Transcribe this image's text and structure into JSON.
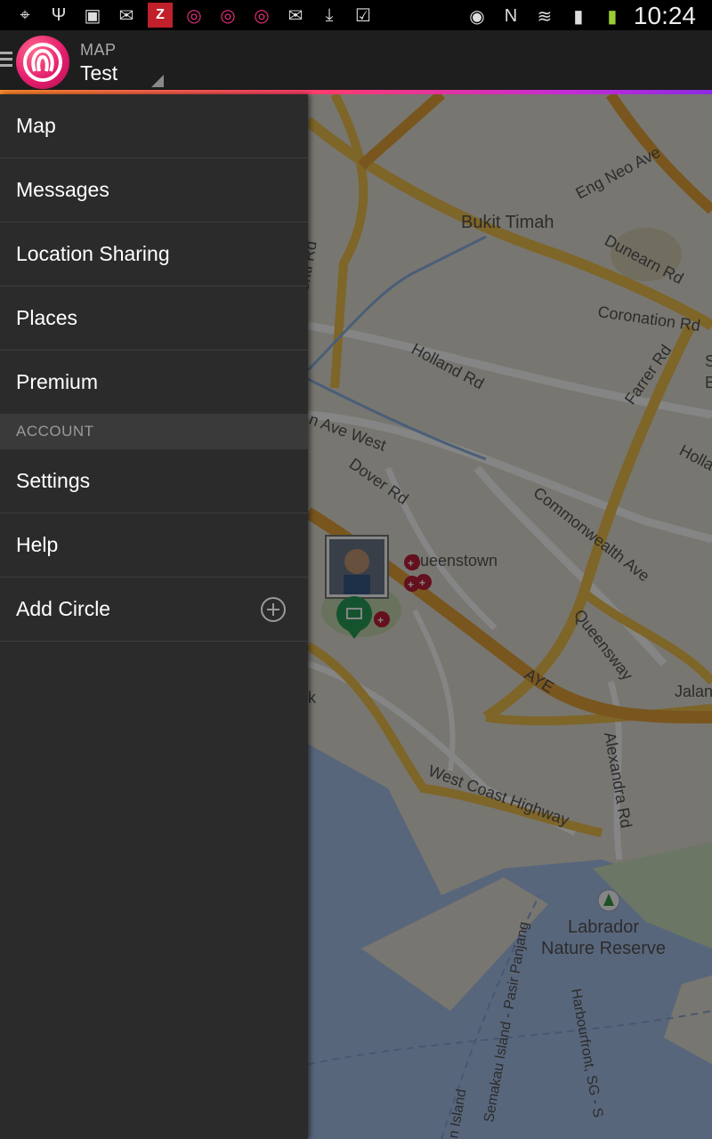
{
  "status_bar": {
    "time": "10:24",
    "left_icons": [
      "gps-icon",
      "usb-icon",
      "image-icon",
      "email-icon",
      "app-n-icon",
      "life360-icon",
      "life360-icon",
      "life360-icon",
      "email-icon",
      "download-icon",
      "clipboard-check-icon"
    ],
    "right_icons": [
      "eye-icon",
      "nfc-icon",
      "wifi-icon",
      "signal-icon",
      "battery-icon"
    ]
  },
  "action_bar": {
    "subtitle": "MAP",
    "title": "Test"
  },
  "drawer": {
    "items": [
      {
        "label": "Map"
      },
      {
        "label": "Messages"
      },
      {
        "label": "Location Sharing"
      },
      {
        "label": "Places"
      },
      {
        "label": "Premium"
      }
    ],
    "account_header": "ACCOUNT",
    "account_items": [
      {
        "label": "Settings"
      },
      {
        "label": "Help"
      },
      {
        "label": "Add Circle"
      }
    ]
  },
  "map": {
    "labels": {
      "eng_neo": "Eng Neo Ave",
      "bukit_timah": "Bukit Timah",
      "dunearn": "Dunearn Rd",
      "coronation": "Coronation Rd",
      "farrer": "Farrer Rd",
      "holland": "Holland Rd",
      "ave_west": "n Ave West",
      "dover": "Dover Rd",
      "commonwealth": "Commonwealth Ave",
      "queenstown": "Queenstown",
      "queensway": "Queensway",
      "aye": "AYE",
      "jalan": "Jalan",
      "west_coast": "West Coast Highway",
      "alexandra": "Alexandra Rd",
      "labrador1": "Labrador",
      "labrador2": "Nature Reserve",
      "pasir_panjang": "Semakau Island - Pasir Panjang",
      "harbourfront": "Harbourfront, SG - S",
      "island": "n Island",
      "enti": "enti Rd",
      "holla": "Holla",
      "k": "k",
      "s": "S",
      "b": "B"
    },
    "colors": {
      "land": "#e6e2d6",
      "water": "#a9c3ee",
      "highway": "#f2c14e",
      "major_road": "#ffffff",
      "expressway": "#e8a53a"
    }
  }
}
